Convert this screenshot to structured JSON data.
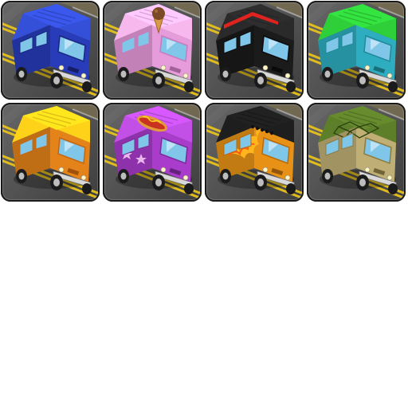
{
  "sprite_sheet": {
    "tiles": [
      {
        "id": "van-blue",
        "name": "blue-van",
        "body": "#2a3fc4",
        "roof": "#3550d8",
        "trim": "#1a2680",
        "decal": "none"
      },
      {
        "id": "van-icecream",
        "name": "ice-cream-van",
        "body": "#f2a3e6",
        "roof": "#f7b8ee",
        "trim": "#c87bbd",
        "decal": "ice-cream-cone"
      },
      {
        "id": "van-black",
        "name": "black-van-red-stripe",
        "body": "#1c1c1c",
        "roof": "#2a2a2a",
        "trim": "#0c0c0c",
        "decal": "red-stripe"
      },
      {
        "id": "van-green",
        "name": "green-teal-van",
        "body": "#2fb6c9",
        "roof": "#2fcf3a",
        "trim": "#1f8a98",
        "decal": "none"
      },
      {
        "id": "van-yellow",
        "name": "yellow-orange-van",
        "body": "#f08a1a",
        "roof": "#ffd21a",
        "trim": "#c76510",
        "decal": "none"
      },
      {
        "id": "van-hotdog",
        "name": "purple-hotdog-van",
        "body": "#b23fd6",
        "roof": "#c350e6",
        "trim": "#7d2a99",
        "decal": "hotdog"
      },
      {
        "id": "van-flames",
        "name": "flame-van",
        "body": "#f39a18",
        "roof": "#1e1e1e",
        "trim": "#b86a0c",
        "decal": "flames"
      },
      {
        "id": "van-turtle",
        "name": "turtle-shell-van",
        "body": "#c9b87a",
        "roof": "#5e7f2a",
        "trim": "#8c7c44",
        "decal": "turtle-shell"
      }
    ],
    "colors": {
      "road": "#5a5a5a",
      "road_dark": "#3e3e3e",
      "lane_yellow": "#e8c21c",
      "tile_border": "#1a1a1a",
      "window": "#7fc6e8",
      "tire": "#1b1b1b",
      "hub": "#bdbdbd"
    }
  }
}
